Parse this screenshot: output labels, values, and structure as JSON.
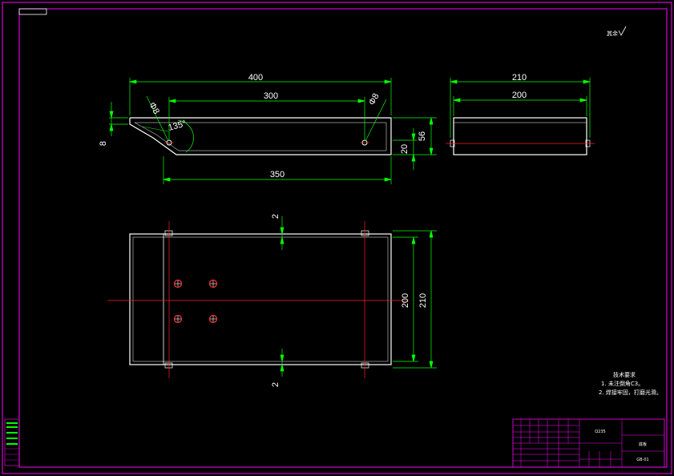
{
  "drawing": {
    "roughness_symbol": "其余",
    "colors": {
      "background": "#000000",
      "outline": "#ffffff",
      "dimension": "#00ff00",
      "centerline": "#ff2020",
      "border": "#ff00ff",
      "hole": "#ff3333"
    }
  },
  "front_view": {
    "dim_overall_length": "400",
    "dim_hole_spacing": "300",
    "dim_bottom_length": "350",
    "dim_height": "56",
    "dim_edge_height": "20",
    "dim_thickness": "8",
    "dim_hole_left": "Φ8",
    "dim_hole_right": "Φ8",
    "dim_angle": "135°"
  },
  "side_view": {
    "dim_outer_width": "210",
    "dim_inner_width": "200"
  },
  "top_view": {
    "dim_inner_width": "200",
    "dim_outer_width": "210",
    "dim_gap_top": "2",
    "dim_gap_bottom": "2"
  },
  "technical_requirements": {
    "title": "技术要求",
    "items": [
      "1. 未注倒角C3。",
      "2. 焊接牢固，打磨光滑。"
    ]
  },
  "title_block": {
    "part_name": "底板",
    "material": "Q235",
    "drawing_no": "GB-01"
  }
}
